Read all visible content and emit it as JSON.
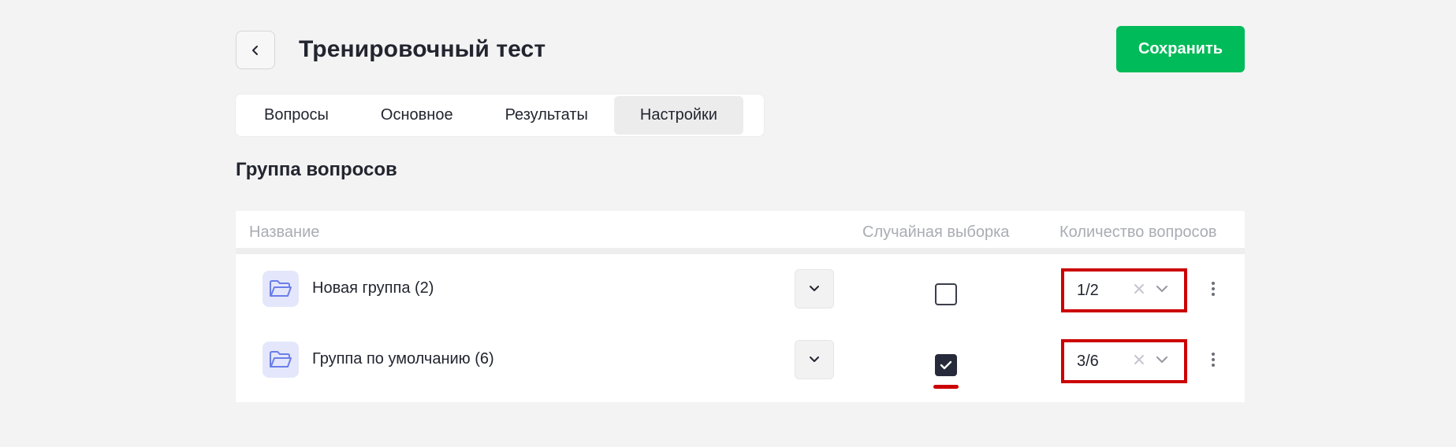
{
  "header": {
    "title": "Тренировочный тест",
    "save_label": "Сохранить"
  },
  "tabs": [
    {
      "label": "Вопросы",
      "active": false
    },
    {
      "label": "Основное",
      "active": false
    },
    {
      "label": "Результаты",
      "active": false
    },
    {
      "label": "Настройки",
      "active": true
    }
  ],
  "section": {
    "title": "Группа вопросов"
  },
  "table": {
    "columns": {
      "name": "Название",
      "random": "Случайная выборка",
      "count": "Количество вопросов"
    },
    "rows": [
      {
        "name": "Новая группа (2)",
        "random_checked": false,
        "count": "1/2"
      },
      {
        "name": "Группа по умолчанию (6)",
        "random_checked": true,
        "count": "3/6"
      }
    ]
  },
  "colors": {
    "accent": "#00bb59",
    "highlight": "#cc0000",
    "folder_icon": "#6b7ee8",
    "checkbox_checked": "#272a3a"
  }
}
